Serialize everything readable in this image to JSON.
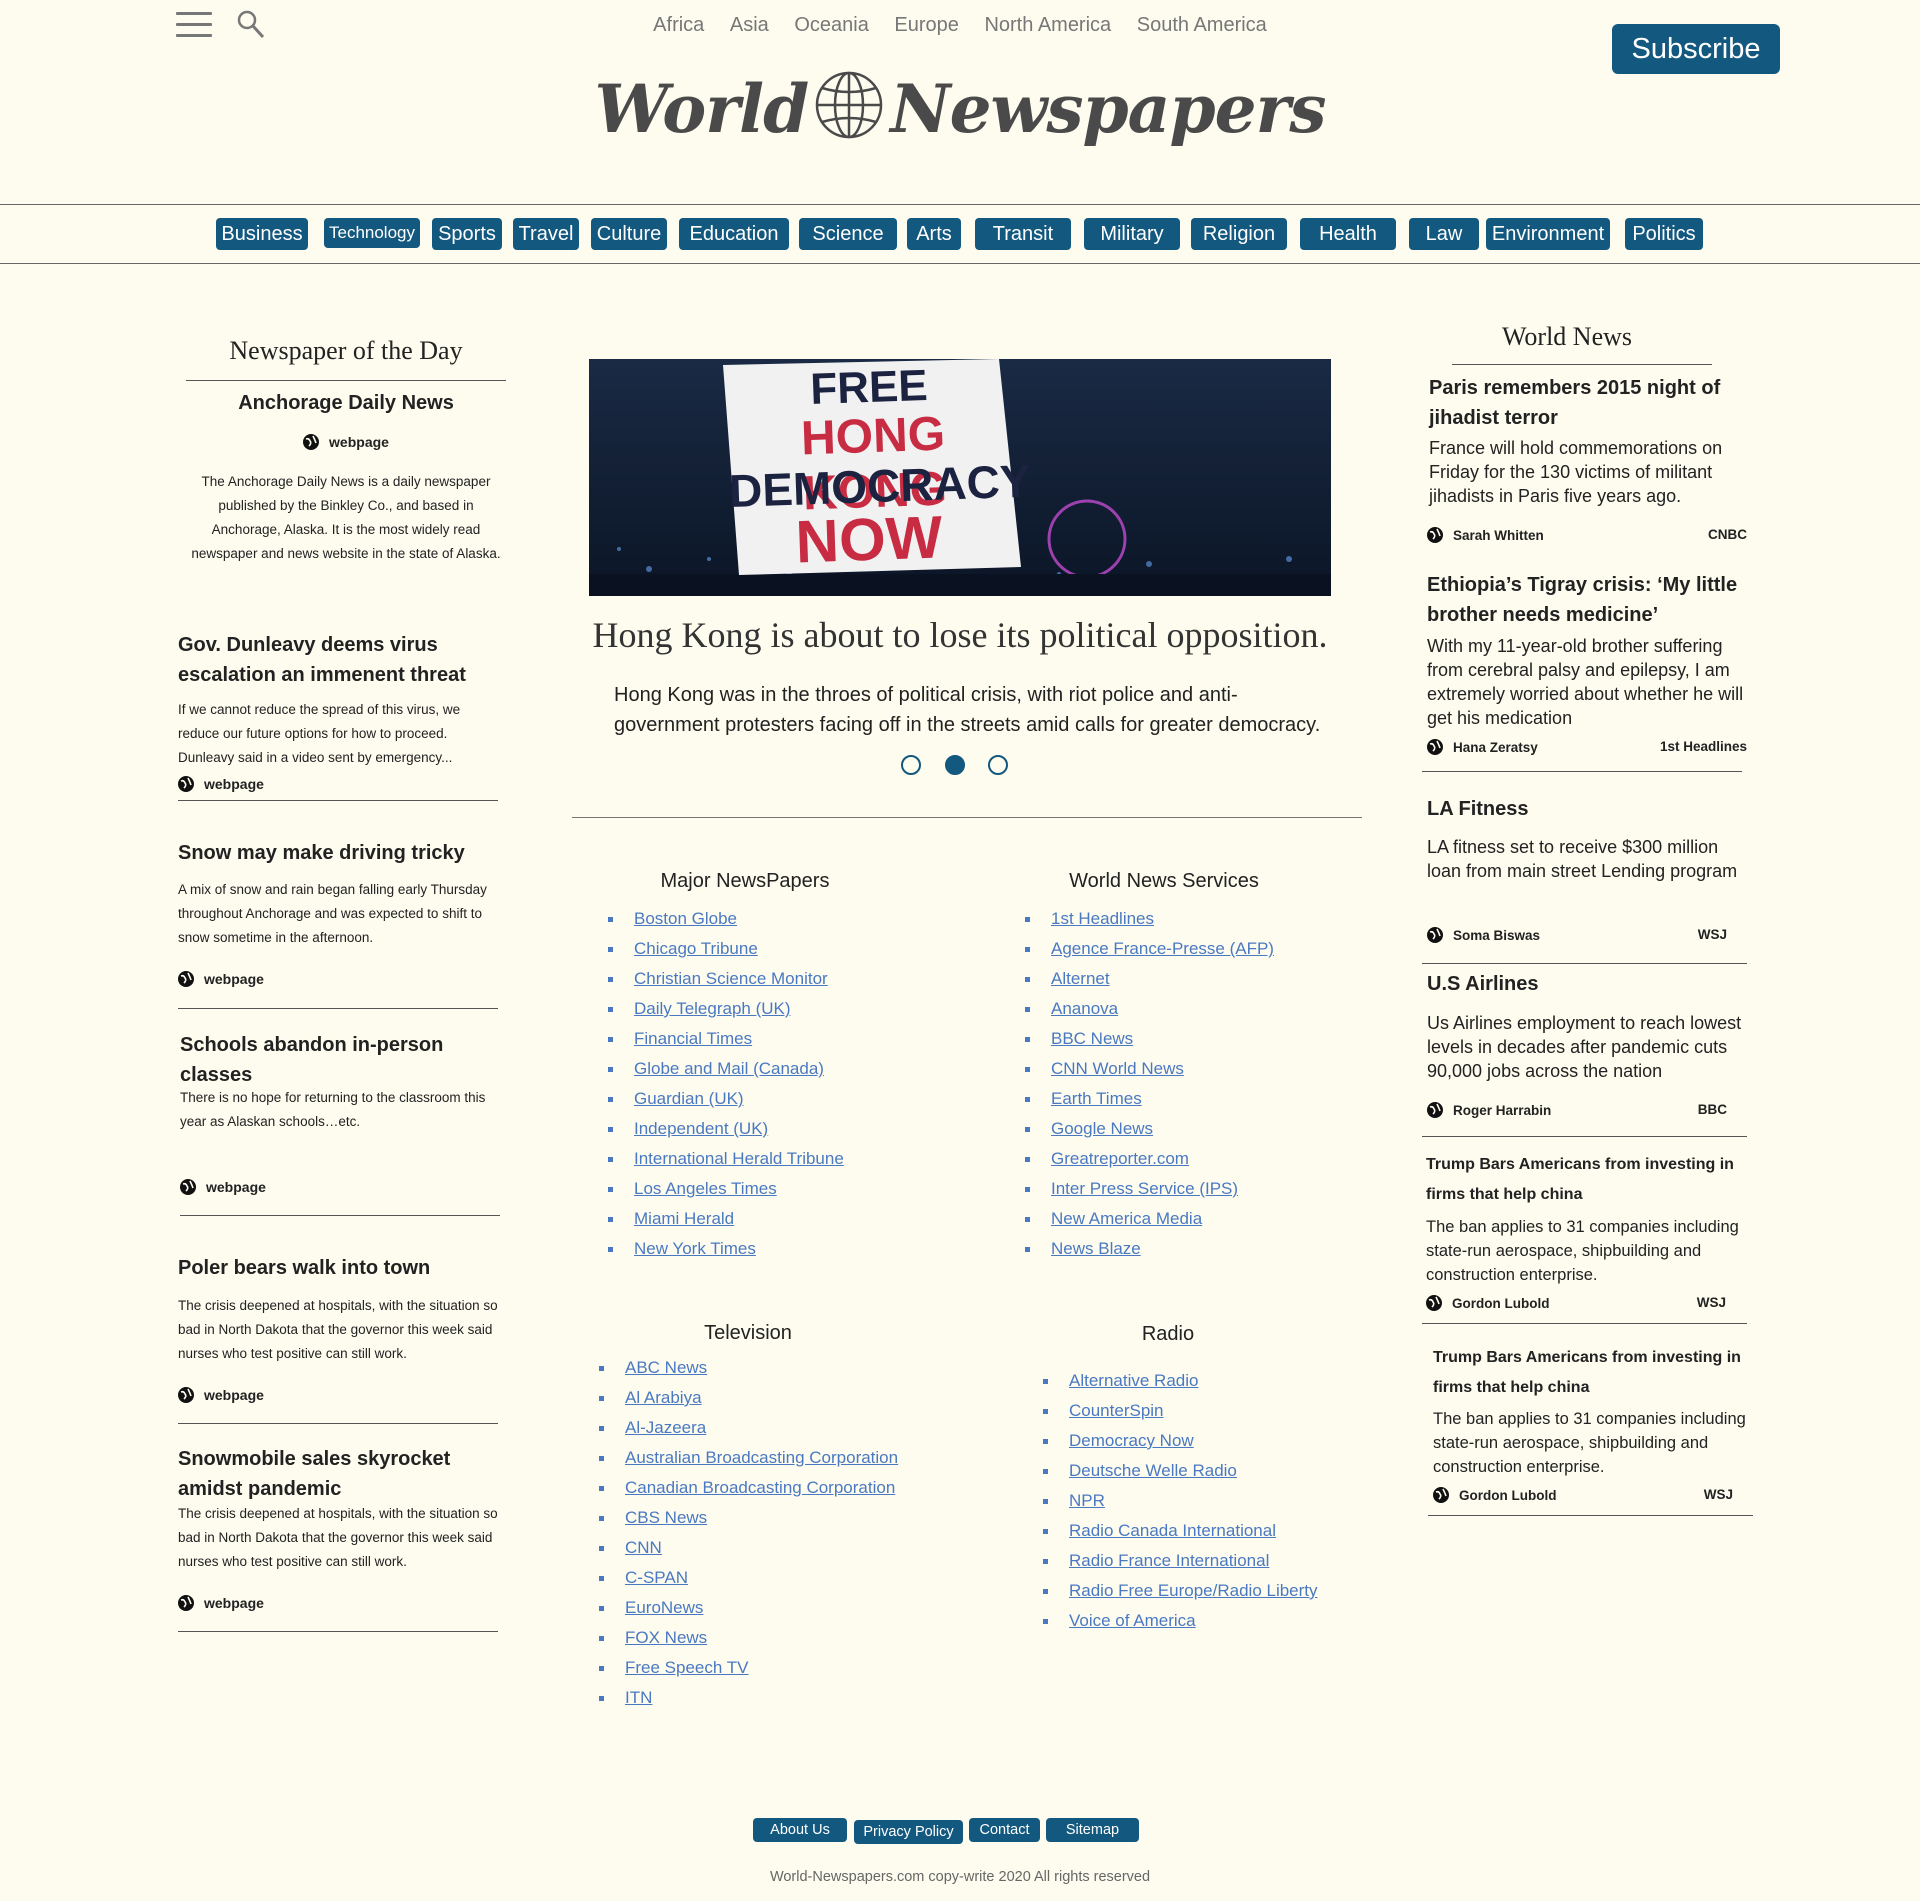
{
  "header": {
    "regions": [
      "Africa",
      "Asia",
      "Oceania",
      "Europe",
      "North America",
      "South America"
    ],
    "subscribe_label": "Subscribe",
    "logo_left": "World",
    "logo_right": "Newspapers"
  },
  "categories": [
    "Business",
    "Technology",
    "Sports",
    "Travel",
    "Culture",
    "Education",
    "Science",
    "Arts",
    "Transit",
    "Military",
    "Religion",
    "Health",
    "Law",
    "Environment",
    "Politics"
  ],
  "left": {
    "heading": "Newspaper of the Day",
    "paper_name": "Anchorage Daily News",
    "paper_link": "webpage",
    "paper_desc": "The Anchorage Daily News is a daily newspaper published by the Binkley Co., and based in Anchorage, Alaska. It is the most widely read newspaper and news website in the state of Alaska.",
    "stories": [
      {
        "title": "Gov. Dunleavy deems virus escalation an immenent threat",
        "desc": "If we cannot reduce the spread of this virus, we reduce our future options for how to proceed. Dunleavy said in a video sent by emergency...",
        "link": "webpage"
      },
      {
        "title": "Snow may make driving tricky",
        "desc": "A mix of snow and rain began falling early Thursday throughout Anchorage and was expected to shift to snow sometime in the afternoon.",
        "link": "webpage"
      },
      {
        "title": "Schools abandon in-person classes",
        "desc": "There is no hope for returning to the classroom this year as Alaskan schools…etc.",
        "link": "webpage"
      },
      {
        "title": "Poler bears walk into town",
        "desc": "The crisis deepened at hospitals, with the situation so bad in North Dakota that the governor this week said nurses who test positive can still work.",
        "link": "webpage"
      },
      {
        "title": "Snowmobile sales skyrocket amidst pandemic",
        "desc": "The crisis deepened at hospitals, with the situation so bad in North Dakota that the governor this week said nurses who test positive can still work.",
        "link": "webpage"
      }
    ]
  },
  "hero": {
    "sign_line1": "FREE",
    "sign_line2": "HONG KONG",
    "sign_line3": "DEMOCRACY",
    "sign_line4": "NOW",
    "title": "Hong Kong is about to lose its political opposition.",
    "desc": "Hong Kong was in the throes of political crisis, with riot police and anti-government protesters facing off in the streets amid calls for greater democracy.",
    "active_slide": 2
  },
  "directory": {
    "major": {
      "heading": "Major NewsPapers",
      "items": [
        "Boston Globe",
        "Chicago Tribune",
        "Christian Science Monitor",
        "Daily Telegraph (UK)",
        "Financial Times",
        "Globe and Mail (Canada)",
        "Guardian (UK)",
        "Independent (UK)",
        "International Herald Tribune",
        "Los Angeles Times",
        "Miami Herald",
        "New York Times"
      ]
    },
    "services": {
      "heading": "World News Services",
      "items": [
        "1st Headlines",
        "Agence France-Presse (AFP)",
        "Alternet",
        "Ananova",
        "BBC News",
        "CNN World News",
        "Earth Times",
        "Google News",
        "Greatreporter.com",
        "Inter Press Service (IPS)",
        "New America Media",
        "News Blaze"
      ]
    },
    "television": {
      "heading": "Television",
      "items": [
        "ABC News",
        "Al Arabiya",
        "Al-Jazeera",
        "Australian Broadcasting Corporation",
        "Canadian Broadcasting Corporation",
        "CBS News",
        "CNN",
        "C-SPAN",
        "EuroNews",
        "FOX News",
        "Free Speech TV",
        "ITN"
      ]
    },
    "radio": {
      "heading": "Radio",
      "items": [
        "Alternative Radio",
        "CounterSpin",
        "Democracy Now",
        "Deutsche Welle Radio",
        "NPR",
        "Radio Canada International",
        "Radio France International",
        "Radio Free Europe/Radio Liberty",
        "Voice of America"
      ]
    }
  },
  "right": {
    "heading": "World News",
    "stories": [
      {
        "title": "Paris remembers 2015 night of jihadist terror",
        "desc": "France will hold commemorations on Friday for the 130 victims of militant jihadists in Paris five years ago.",
        "author": "Sarah Whitten",
        "source": "CNBC"
      },
      {
        "title": "Ethiopia’s Tigray crisis: ‘My little brother needs medicine’",
        "desc": "With my 11-year-old brother suffering from cerebral palsy and epilepsy, I am extremely worried about whether he will get his medication",
        "author": "Hana Zeratsy",
        "source": "1st Headlines"
      },
      {
        "title": "LA Fitness",
        "desc": "LA fitness set to receive $300 million loan from main street Lending program",
        "author": "Soma Biswas",
        "source": "WSJ"
      },
      {
        "title": "U.S Airlines",
        "desc": "Us Airlines employment to reach lowest levels in decades after pandemic cuts 90,000 jobs across the nation",
        "author": "Roger Harrabin",
        "source": "BBC"
      },
      {
        "title": "Trump Bars Americans from investing in firms that help china",
        "desc": "The ban applies to 31 companies including state-run aerospace, shipbuilding and construction enterprise.",
        "author": "Gordon Lubold",
        "source": "WSJ"
      },
      {
        "title": "Trump Bars Americans from investing in firms that help china",
        "desc": "The ban applies to 31 companies including state-run aerospace, shipbuilding and construction enterprise.",
        "author": "Gordon Lubold",
        "source": "WSJ"
      }
    ]
  },
  "footer": {
    "links": [
      "About Us",
      "Privacy Policy",
      "Contact",
      "Sitemap"
    ],
    "copyright": "World-Newspapers.com copy-write 2020 All rights reserved"
  },
  "colors": {
    "accent": "#13587f",
    "background": "#fdfcef",
    "link": "#4a79c2"
  }
}
